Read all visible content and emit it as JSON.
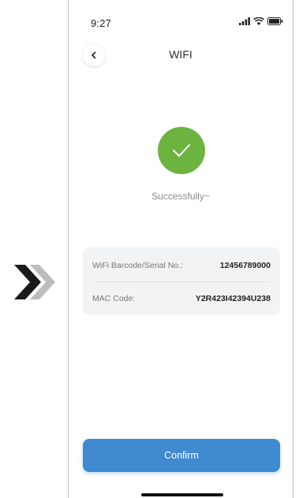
{
  "status_bar": {
    "time": "9:27",
    "icons": [
      "signal-icon",
      "wifi-icon",
      "battery-icon"
    ]
  },
  "nav": {
    "title": "WIFI",
    "back_icon": "chevron-left-icon"
  },
  "success": {
    "icon": "checkmark-icon",
    "message": "Successfully~",
    "color": "#6db33f"
  },
  "info": {
    "rows": [
      {
        "label": "WiFi Barcode/Serial No.:",
        "value": "12456789000"
      },
      {
        "label": "MAC Code:",
        "value": "Y2R423I42394U238"
      }
    ]
  },
  "confirm": {
    "label": "Confirm",
    "color": "#3f8ad1"
  },
  "decor": {
    "arrows_icon": "double-chevron-right-icon",
    "colors": [
      "#1a1a1a",
      "#bdbdbd"
    ]
  }
}
